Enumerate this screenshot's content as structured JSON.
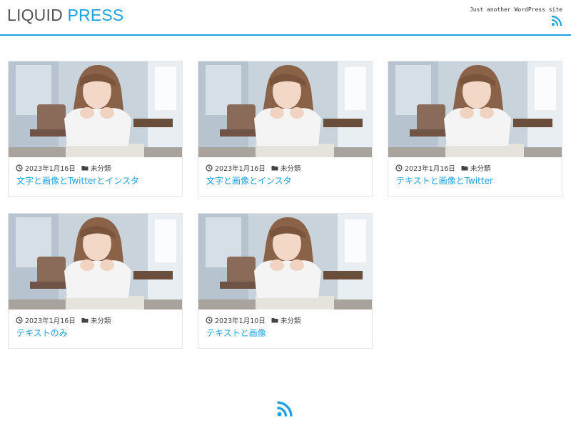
{
  "site": {
    "title_part1": "LIQUID",
    "title_part2": "PRESS",
    "tagline": "Just another WordPress site",
    "accent_color": "#1da1e0"
  },
  "icons": {
    "header_feed": "rss-icon",
    "footer_feed": "rss-icon",
    "date": "clock-icon",
    "category": "folder-icon"
  },
  "posts": [
    {
      "date": "2023年1月16日",
      "category": "未分類",
      "title": "文字と画像とTwitterとインスタ",
      "thumbnail": "photo-woman-chin-on-hands"
    },
    {
      "date": "2023年1月16日",
      "category": "未分類",
      "title": "文字と画像とインスタ",
      "thumbnail": "photo-woman-chin-on-hands"
    },
    {
      "date": "2023年1月16日",
      "category": "未分類",
      "title": "テキストと画像とTwitter",
      "thumbnail": "photo-woman-chin-on-hands"
    },
    {
      "date": "2023年1月16日",
      "category": "未分類",
      "title": "テキストのみ",
      "thumbnail": "photo-woman-chin-on-hands"
    },
    {
      "date": "2023年1月10日",
      "category": "未分類",
      "title": "テキストと画像",
      "thumbnail": "photo-woman-chin-on-hands"
    }
  ]
}
